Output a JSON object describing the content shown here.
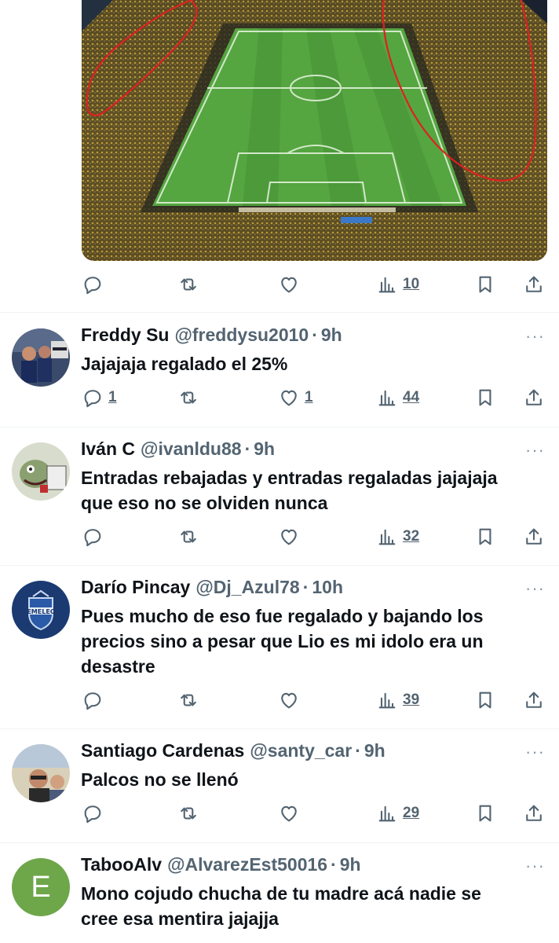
{
  "top_tweet": {
    "image_alt": "stadium-photo",
    "stats": {
      "views": "10"
    }
  },
  "replies": [
    {
      "name": "Freddy Su",
      "handle": "@freddysu2010",
      "time": "9h",
      "text_lines": [
        "Jajajaja regalado el 25%"
      ],
      "stats": {
        "replies": "1",
        "likes": "1",
        "views": "44"
      },
      "avatar": "group-photo"
    },
    {
      "name": "Iván C",
      "handle": "@ivanldu88",
      "time": "9h",
      "text_lines": [
        "Entradas rebajadas y entradas regaladas jajajaja",
        "que eso no se olviden nunca"
      ],
      "stats": {
        "replies": "",
        "likes": "",
        "views": "32"
      },
      "avatar": "cartoon-drawing"
    },
    {
      "name": "Darío Pincay",
      "handle": "@Dj_Azul78",
      "time": "10h",
      "text_lines": [
        "Pues mucho de eso fue regalado y bajando los",
        "precios sino a pesar que Lio es mi idolo era un",
        "desastre"
      ],
      "stats": {
        "replies": "",
        "likes": "",
        "views": "39"
      },
      "avatar": "emelec-crest"
    },
    {
      "name": "Santiago Cardenas",
      "handle": "@santy_car",
      "time": "9h",
      "text_lines": [
        "Palcos no se llenó"
      ],
      "stats": {
        "replies": "",
        "likes": "",
        "views": "29"
      },
      "avatar": "beach-photo"
    },
    {
      "name": "TabooAlv",
      "handle": "@AlvarezEst50016",
      "time": "9h",
      "text_lines": [
        "Mono cojudo chucha de tu madre acá nadie se",
        "cree esa mentira jajajja"
      ],
      "stats": {
        "replies": "",
        "likes": "",
        "views": ""
      },
      "avatar": "letter-avatar",
      "avatar_letter": "E",
      "avatar_color": "#6ea64a"
    }
  ],
  "ui": {
    "more_glyph": "···",
    "separator": "·"
  },
  "colors": {
    "text": "#0f1419",
    "secondary": "#536471",
    "divider": "#eff3f4"
  }
}
